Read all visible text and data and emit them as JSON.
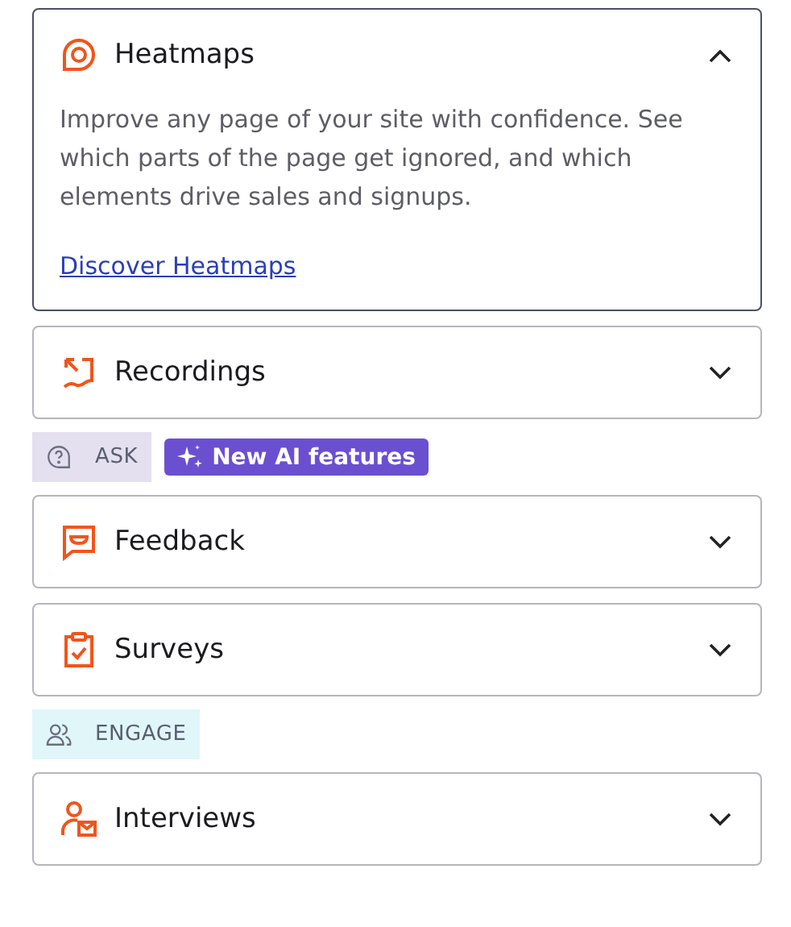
{
  "items": [
    {
      "kind": "accordion",
      "title": "Heatmaps",
      "expanded": true,
      "description": "Improve any page of your site with confidence. See which parts of the page get ignored, and which elements drive sales and signups.",
      "link": "Discover Heatmaps"
    },
    {
      "kind": "accordion",
      "title": "Recordings",
      "expanded": false
    },
    {
      "kind": "section",
      "label": "ASK",
      "color": "#e4e0f0",
      "badge": "New AI features"
    },
    {
      "kind": "accordion",
      "title": "Feedback",
      "expanded": false
    },
    {
      "kind": "accordion",
      "title": "Surveys",
      "expanded": false
    },
    {
      "kind": "section",
      "label": "ENGAGE",
      "color": "#e0f6f9"
    },
    {
      "kind": "accordion",
      "title": "Interviews",
      "expanded": false
    }
  ]
}
